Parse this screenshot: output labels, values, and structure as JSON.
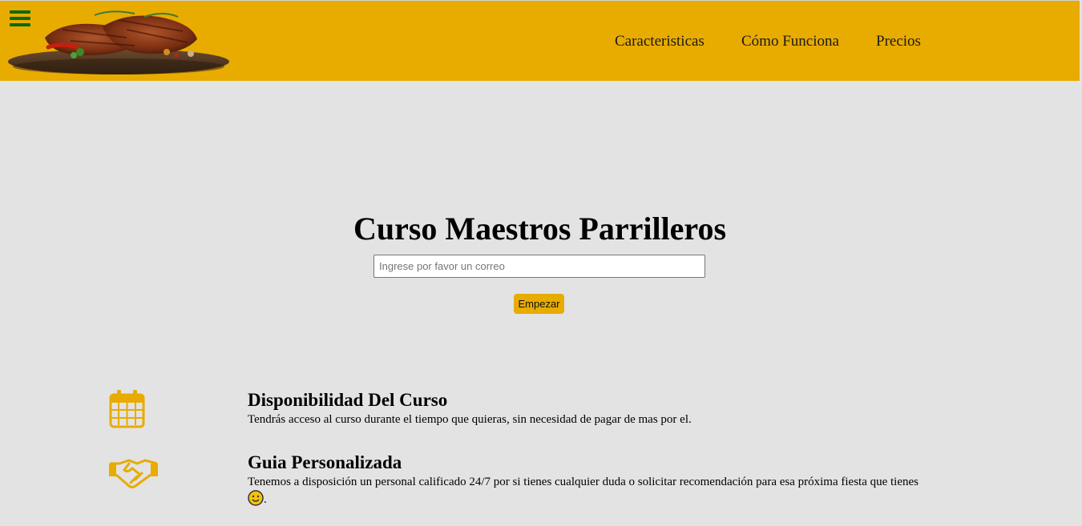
{
  "header": {
    "logo_alt": "Grilled meat with vegetables on a wooden board",
    "menu_icon": "hamburger-menu-icon",
    "nav": [
      {
        "label": "Caracteristicas"
      },
      {
        "label": "Cómo Funciona"
      },
      {
        "label": "Precios"
      }
    ]
  },
  "hero": {
    "title": "Curso Maestros Parrilleros",
    "email_placeholder": "Ingrese por favor un correo",
    "button_label": "Empezar"
  },
  "features": [
    {
      "icon": "calendar-icon",
      "title": "Disponibilidad Del Curso",
      "description": "Tendrás acceso al curso durante el tiempo que quieras, sin necesidad de pagar de mas por el."
    },
    {
      "icon": "handshake-icon",
      "title": "Guia Personalizada",
      "description": "Tenemos a disposición un personal calificado 24/7 por si tienes cualquier duda o solicitar recomendación para esa próxima fiesta que tienes",
      "description_end": "."
    }
  ],
  "colors": {
    "header_bg": "#e8ab00",
    "page_bg": "#e3e3e3",
    "accent": "#e8ab00",
    "menu_icon": "#0a6b0a"
  }
}
